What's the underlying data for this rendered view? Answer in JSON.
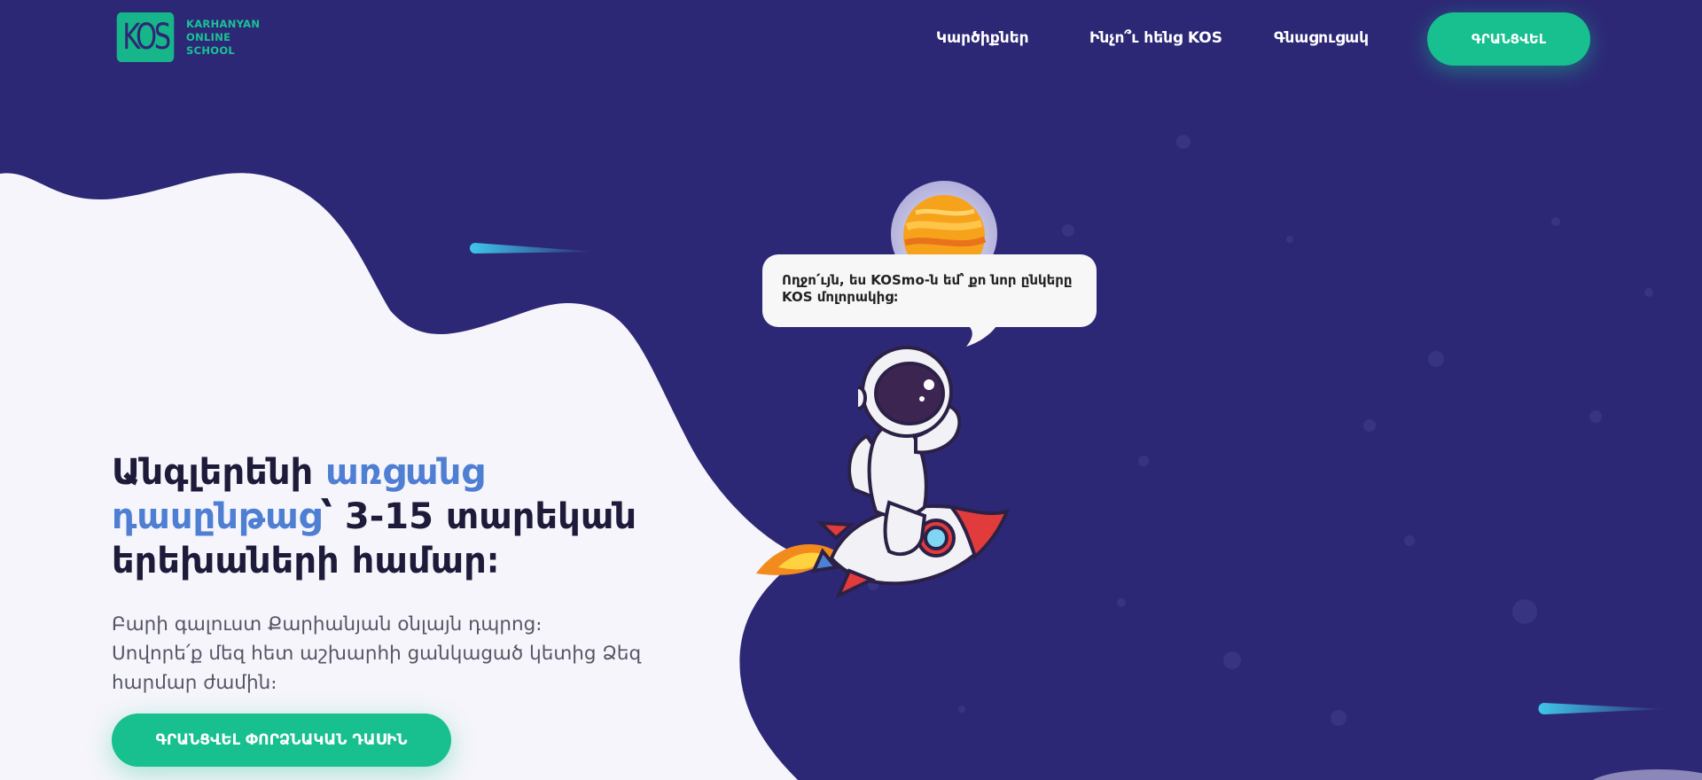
{
  "brand": {
    "logo_mark": "KOS",
    "logo_line1": "KARHANYAN",
    "logo_line2": "ONLINE",
    "logo_line3": "SCHOOL"
  },
  "nav": {
    "items": [
      {
        "label": "Կարծիքներ"
      },
      {
        "label": "Ինչո՞ւ հենց KOS"
      },
      {
        "label": "Գնացուցակ"
      }
    ],
    "register_label": "ԳՐԱՆՑՎԵԼ"
  },
  "hero": {
    "title_part1": "Անգլերենի ",
    "title_accent": "առցանց դասընթաց",
    "title_part2": "՝ 3-15 տարեկան երեխաների համար։",
    "description_line1": "Բարի գալուստ Քարիանյան օնլայն դպրոց։",
    "description_line2": "Սովորե՛ք մեզ հետ աշխարհի ցանկացած կետից Ձեզ հարմար ժամին։",
    "cta_label": "ԳՐԱՆՑՎԵԼ ՓՈՐՁՆԱԿԱՆ ԴԱՍԻՆ"
  },
  "mascot": {
    "speech": "Ողջո՛ւյն, ես KOSmo-ն եմ՝ քո նոր ընկերը KOS մոլորակից։"
  },
  "colors": {
    "background": "#2d2876",
    "accent_green": "#17c08e",
    "accent_blue": "#4e7fd3",
    "hero_panel": "#f5f5fb"
  },
  "icons": [
    "planet-icon",
    "astronaut-illustration",
    "rocket-illustration",
    "comet-icon"
  ]
}
